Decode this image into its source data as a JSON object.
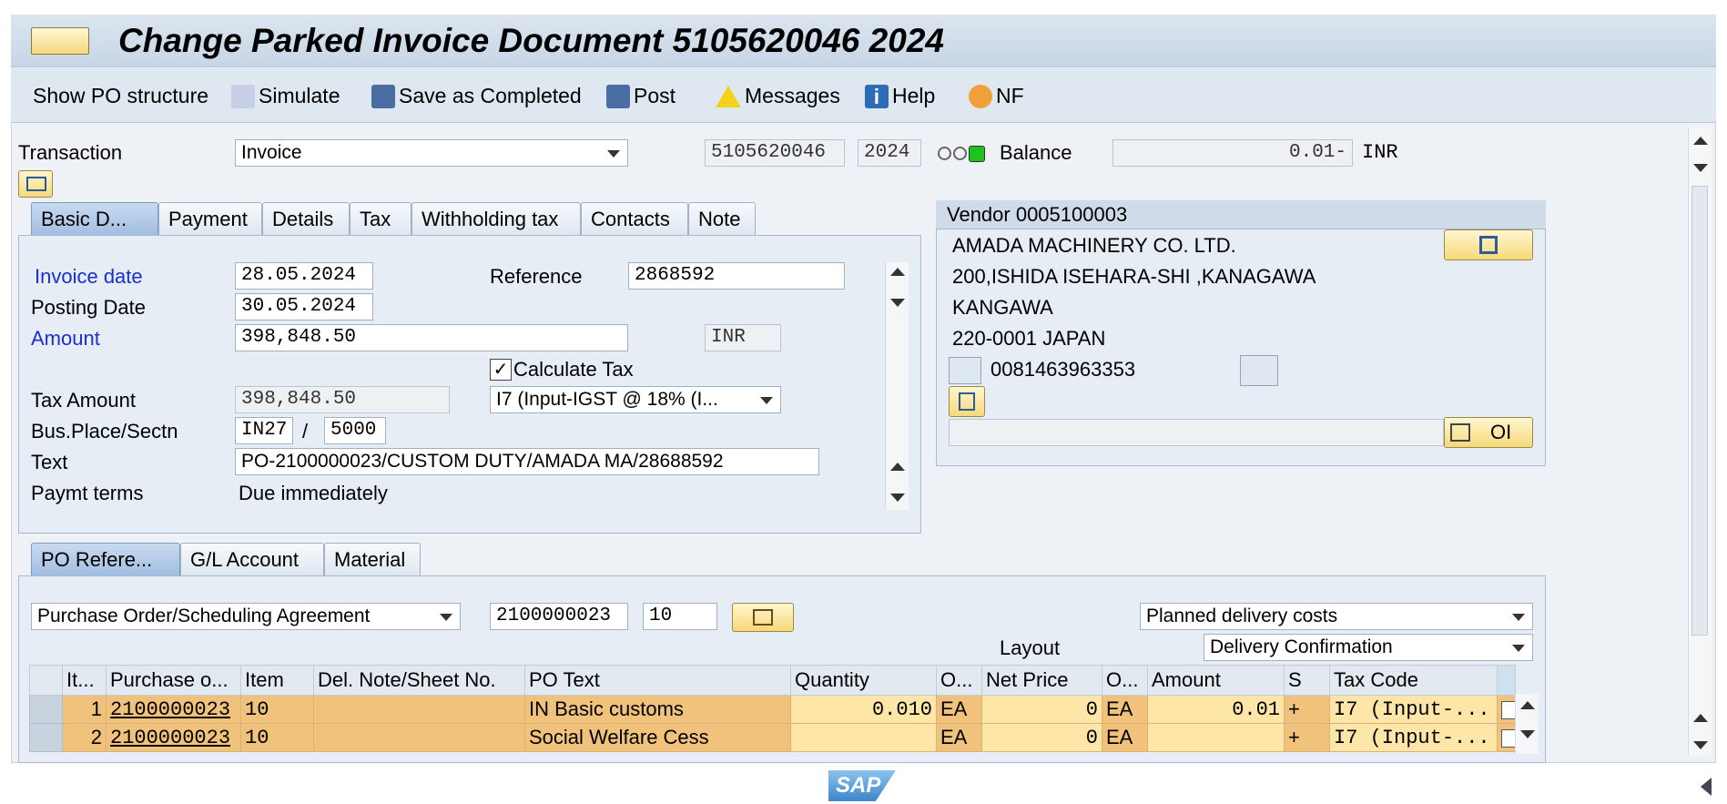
{
  "window": {
    "title": "Change Parked Invoice Document 5105620046 2024"
  },
  "toolbar": {
    "show_po_structure": "Show PO structure",
    "simulate": "Simulate",
    "save_completed": "Save as Completed",
    "post": "Post",
    "messages": "Messages",
    "help": "Help",
    "nf": "NF"
  },
  "header": {
    "transaction_label": "Transaction",
    "transaction_value": "Invoice",
    "doc_number": "5105620046",
    "fiscal_year": "2024",
    "balance_label": "Balance",
    "balance_value": "0.01-",
    "currency": "INR"
  },
  "tabs_top": [
    "Basic D...",
    "Payment",
    "Details",
    "Tax",
    "Withholding tax",
    "Contacts",
    "Note"
  ],
  "basic": {
    "invoice_date_label": "Invoice date",
    "invoice_date": "28.05.2024",
    "reference_label": "Reference",
    "reference": "2868592",
    "posting_date_label": "Posting Date",
    "posting_date": "30.05.2024",
    "amount_label": "Amount",
    "amount": "398,848.50",
    "amount_currency": "INR",
    "calc_tax_label": "Calculate Tax",
    "tax_amount_label": "Tax Amount",
    "tax_amount": "398,848.50",
    "tax_code": "I7 (Input-IGST @ 18% (I...",
    "bus_place_label": "Bus.Place/Sectn",
    "bus_place": "IN27",
    "section_sep": "/",
    "section": "5000",
    "text_label": "Text",
    "text": "PO-2100000023/CUSTOM DUTY/AMADA MA/28688592",
    "paymt_terms_label": "Paymt terms",
    "paymt_terms": "Due immediately"
  },
  "vendor": {
    "title": "Vendor 0005100003",
    "name": "AMADA MACHINERY CO. LTD.",
    "address1": "200,ISHIDA ISEHARA-SHI ,KANAGAWA",
    "address2": "KANGAWA",
    "address3": "220-0001 JAPAN",
    "phone": "0081463963353",
    "oi_label": "OI"
  },
  "tabs_bottom": [
    "PO Refere...",
    "G/L Account",
    "Material"
  ],
  "po": {
    "ref_type": "Purchase Order/Scheduling Agreement",
    "po_number": "2100000023",
    "item": "10",
    "delivery_costs": "Planned delivery costs",
    "layout_label": "Layout",
    "layout_value": "Delivery Confirmation"
  },
  "grid": {
    "columns": [
      "It...",
      "Purchase o...",
      "Item",
      "Del. Note/Sheet No.",
      "PO Text",
      "Quantity",
      "O...",
      "Net Price",
      "O...",
      "Amount",
      "S",
      "Tax Code"
    ],
    "rows": [
      {
        "it": "1",
        "po": "2100000023",
        "item": "10",
        "del": "",
        "text": "IN Basic customs",
        "qty": "0.010",
        "oun": "EA",
        "net": "0",
        "opu": "EA",
        "amount": "0.01",
        "s": "+",
        "tax": "I7 (Input-..."
      },
      {
        "it": "2",
        "po": "2100000023",
        "item": "10",
        "del": "",
        "text": "Social Welfare Cess",
        "qty": "",
        "oun": "EA",
        "net": "0",
        "opu": "EA",
        "amount": "",
        "s": "+",
        "tax": "I7 (Input-..."
      }
    ]
  },
  "brand": {
    "logo": "SAP"
  }
}
